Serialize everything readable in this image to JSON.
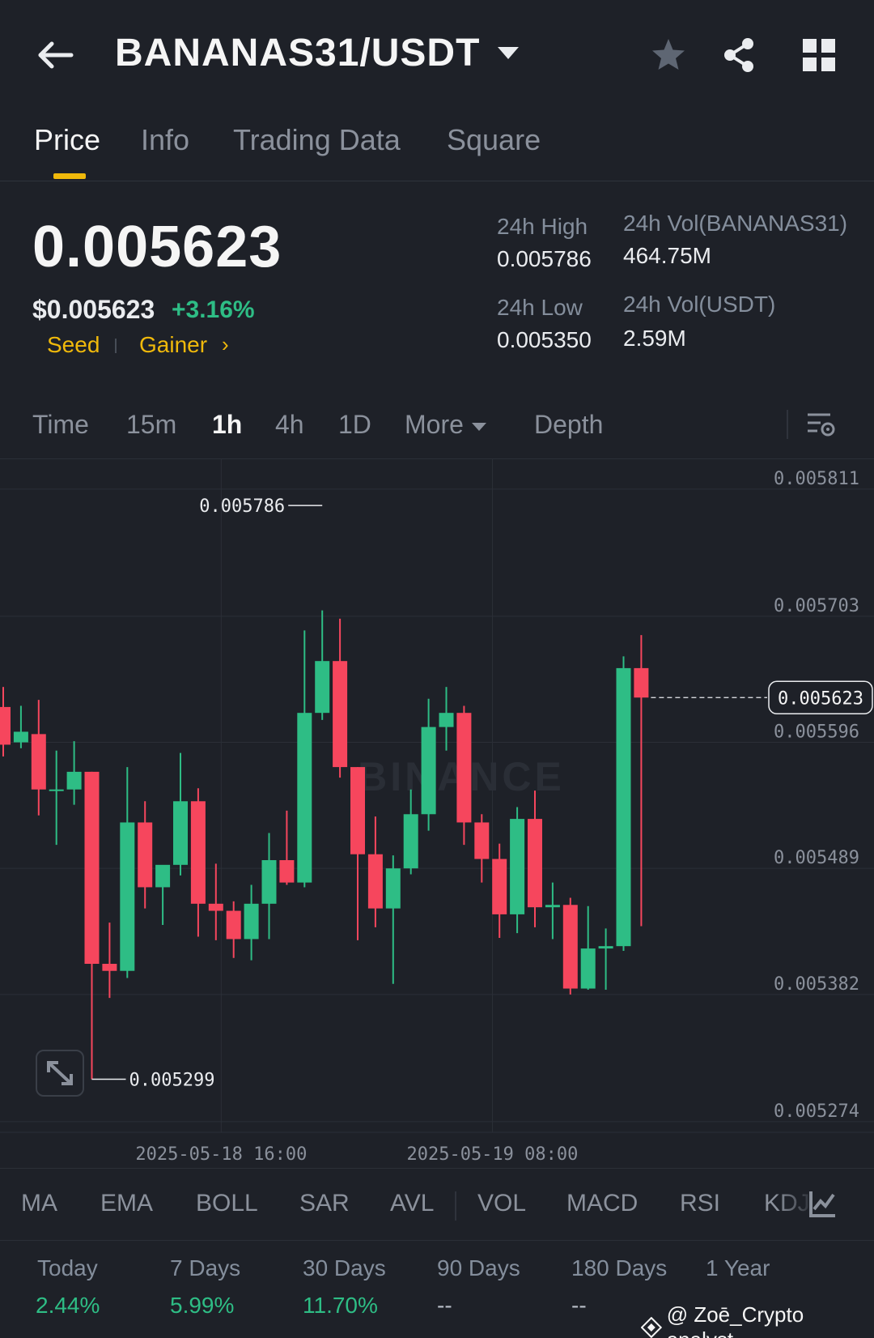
{
  "header": {
    "pair": "BANANAS31/USDT"
  },
  "tabs": [
    {
      "label": "Price",
      "active": true
    },
    {
      "label": "Info",
      "active": false
    },
    {
      "label": "Trading Data",
      "active": false
    },
    {
      "label": "Square",
      "active": false
    }
  ],
  "ticker": {
    "last_price": "0.005623",
    "usd_price": "$0.005623",
    "change_pct": "+3.16%",
    "tags": [
      "Seed",
      "Gainer"
    ],
    "high_label": "24h High",
    "high_value": "0.005786",
    "low_label": "24h Low",
    "low_value": "0.005350",
    "vol_base_label": "24h Vol(BANANAS31)",
    "vol_base_value": "464.75M",
    "vol_quote_label": "24h Vol(USDT)",
    "vol_quote_value": "2.59M"
  },
  "intervals": {
    "time": "Time",
    "m15": "15m",
    "h1": "1h",
    "h4": "4h",
    "d1": "1D",
    "more": "More",
    "depth": "Depth",
    "active": "1h"
  },
  "chart_data": {
    "type": "candlestick",
    "y_ticks": [
      "0.005811",
      "0.005703",
      "0.005596",
      "0.005489",
      "0.005382",
      "0.005274"
    ],
    "ylim": [
      0.005254,
      0.005826
    ],
    "x_ticks": [
      "2025-05-18 16:00",
      "2025-05-19 08:00"
    ],
    "high_marker": "0.005786",
    "low_marker": "0.005299",
    "current_price": "0.005623",
    "watermark": "BINANCE",
    "colors": {
      "up": "#2ebd85",
      "down": "#f6465d"
    },
    "candles": [
      {
        "o": 0.005615,
        "h": 0.005632,
        "l": 0.005573,
        "c": 0.005583
      },
      {
        "o": 0.005585,
        "h": 0.005616,
        "l": 0.00558,
        "c": 0.005594
      },
      {
        "o": 0.005592,
        "h": 0.005621,
        "l": 0.005523,
        "c": 0.005545
      },
      {
        "o": 0.005545,
        "h": 0.005578,
        "l": 0.005498,
        "c": 0.005545
      },
      {
        "o": 0.005545,
        "h": 0.005586,
        "l": 0.005532,
        "c": 0.00556
      },
      {
        "o": 0.00556,
        "h": 0.00556,
        "l": 0.005299,
        "c": 0.005397
      },
      {
        "o": 0.005397,
        "h": 0.005432,
        "l": 0.005368,
        "c": 0.005391
      },
      {
        "o": 0.005391,
        "h": 0.005564,
        "l": 0.005385,
        "c": 0.005517
      },
      {
        "o": 0.005517,
        "h": 0.005535,
        "l": 0.005444,
        "c": 0.005462
      },
      {
        "o": 0.005462,
        "h": 0.00548,
        "l": 0.00543,
        "c": 0.005481
      },
      {
        "o": 0.005481,
        "h": 0.005576,
        "l": 0.005472,
        "c": 0.005535
      },
      {
        "o": 0.005535,
        "h": 0.005546,
        "l": 0.00542,
        "c": 0.005448
      },
      {
        "o": 0.005448,
        "h": 0.005482,
        "l": 0.005417,
        "c": 0.005442
      },
      {
        "o": 0.005442,
        "h": 0.00545,
        "l": 0.005402,
        "c": 0.005418
      },
      {
        "o": 0.005418,
        "h": 0.005464,
        "l": 0.0054,
        "c": 0.005448
      },
      {
        "o": 0.005448,
        "h": 0.005508,
        "l": 0.005418,
        "c": 0.005485
      },
      {
        "o": 0.005485,
        "h": 0.005527,
        "l": 0.005464,
        "c": 0.005466
      },
      {
        "o": 0.005466,
        "h": 0.00568,
        "l": 0.005462,
        "c": 0.00561
      },
      {
        "o": 0.00561,
        "h": 0.005697,
        "l": 0.005604,
        "c": 0.005654
      },
      {
        "o": 0.005654,
        "h": 0.00569,
        "l": 0.005555,
        "c": 0.005564
      },
      {
        "o": 0.005564,
        "h": 0.005564,
        "l": 0.005417,
        "c": 0.00549
      },
      {
        "o": 0.00549,
        "h": 0.005522,
        "l": 0.005428,
        "c": 0.005444
      },
      {
        "o": 0.005444,
        "h": 0.005489,
        "l": 0.00538,
        "c": 0.005478
      },
      {
        "o": 0.005478,
        "h": 0.005545,
        "l": 0.005473,
        "c": 0.005524
      },
      {
        "o": 0.005524,
        "h": 0.005622,
        "l": 0.00551,
        "c": 0.005598
      },
      {
        "o": 0.005598,
        "h": 0.005632,
        "l": 0.005578,
        "c": 0.00561
      },
      {
        "o": 0.00561,
        "h": 0.005616,
        "l": 0.005498,
        "c": 0.005517
      },
      {
        "o": 0.005517,
        "h": 0.005524,
        "l": 0.005466,
        "c": 0.005486
      },
      {
        "o": 0.005486,
        "h": 0.005499,
        "l": 0.005419,
        "c": 0.005439
      },
      {
        "o": 0.005439,
        "h": 0.00553,
        "l": 0.005423,
        "c": 0.00552
      },
      {
        "o": 0.00552,
        "h": 0.005544,
        "l": 0.005428,
        "c": 0.005445
      },
      {
        "o": 0.005445,
        "h": 0.005466,
        "l": 0.005418,
        "c": 0.005447
      },
      {
        "o": 0.005447,
        "h": 0.005453,
        "l": 0.005371,
        "c": 0.005376
      },
      {
        "o": 0.005376,
        "h": 0.005446,
        "l": 0.005375,
        "c": 0.00541
      },
      {
        "o": 0.00541,
        "h": 0.005427,
        "l": 0.005375,
        "c": 0.005412
      },
      {
        "o": 0.005412,
        "h": 0.005658,
        "l": 0.005408,
        "c": 0.005648
      },
      {
        "o": 0.005648,
        "h": 0.005676,
        "l": 0.005429,
        "c": 0.005623
      }
    ]
  },
  "indicators": [
    "MA",
    "EMA",
    "BOLL",
    "SAR",
    "AVL",
    "VOL",
    "MACD",
    "RSI",
    "KDJ"
  ],
  "performance": [
    {
      "label": "Today",
      "value": "2.44%"
    },
    {
      "label": "7 Days",
      "value": "5.99%"
    },
    {
      "label": "30 Days",
      "value": "11.70%"
    },
    {
      "label": "90 Days",
      "value": "--"
    },
    {
      "label": "180 Days",
      "value": "--"
    },
    {
      "label": "1 Year",
      "value": ""
    }
  ],
  "watermark_credit": "@ Zoē_Crypto analyst",
  "icons": {
    "back": "back-arrow-icon",
    "favorite": "star-icon",
    "share": "share-icon",
    "grid": "grid-icon",
    "chart_settings": "chart-settings-icon",
    "expand": "expand-icon",
    "indicator_settings": "indicator-chart-icon"
  }
}
